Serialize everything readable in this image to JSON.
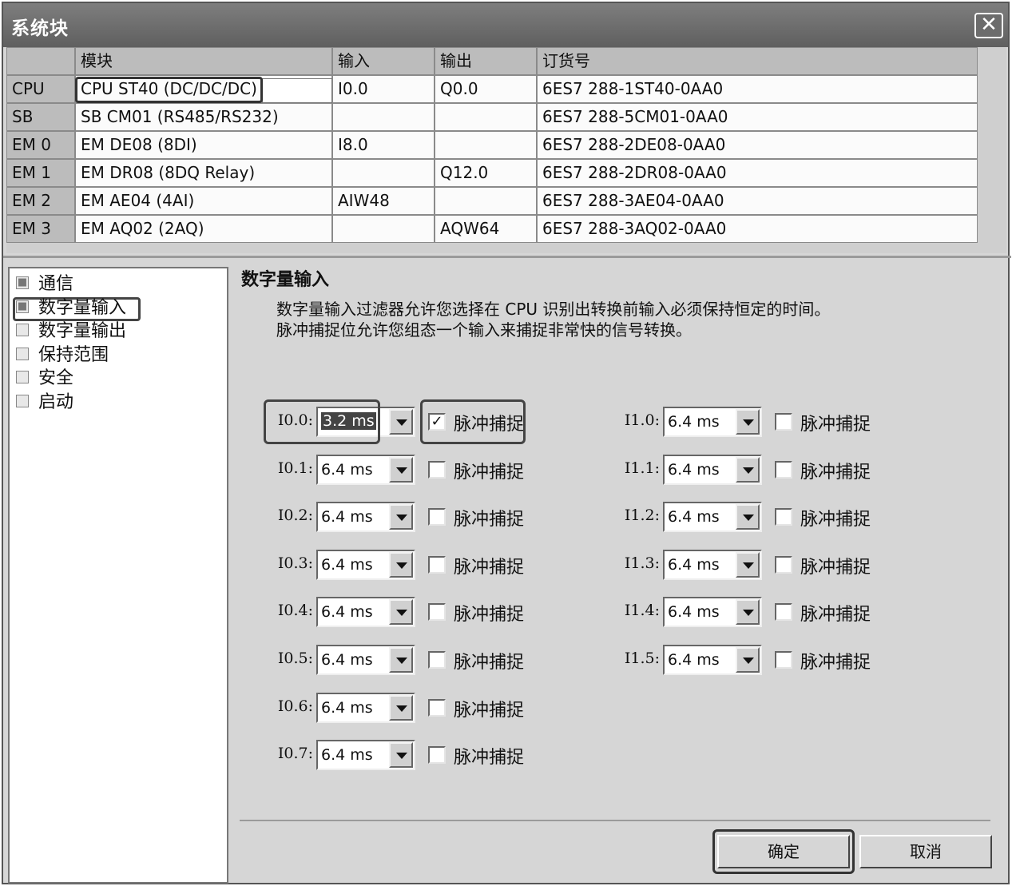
{
  "window": {
    "title": "系统块",
    "close_glyph": "✕"
  },
  "module_table": {
    "headers": [
      "",
      "模块",
      "输入",
      "输出",
      "订货号"
    ],
    "rows": [
      [
        "CPU",
        "CPU ST40 (DC/DC/DC)",
        "I0.0",
        "Q0.0",
        "6ES7 288-1ST40-0AA0"
      ],
      [
        "SB",
        "SB CM01 (RS485/RS232)",
        "",
        "",
        "6ES7 288-5CM01-0AA0"
      ],
      [
        "EM 0",
        "EM DE08 (8DI)",
        "I8.0",
        "",
        "6ES7 288-2DE08-0AA0"
      ],
      [
        "EM 1",
        "EM DR08 (8DQ Relay)",
        "",
        "Q12.0",
        "6ES7 288-2DR08-0AA0"
      ],
      [
        "EM 2",
        "EM AE04 (4AI)",
        "AIW48",
        "",
        "6ES7 288-3AE04-0AA0"
      ],
      [
        "EM 3",
        "EM AQ02 (2AQ)",
        "",
        "AQW64",
        "6ES7 288-3AQ02-0AA0"
      ]
    ]
  },
  "tree": {
    "items": [
      {
        "label": "通信",
        "checked": true
      },
      {
        "label": "数字量输入",
        "checked": true,
        "selected": true
      },
      {
        "label": "数字量输出",
        "checked": false
      },
      {
        "label": "保持范围",
        "checked": false
      },
      {
        "label": "安全",
        "checked": false
      },
      {
        "label": "启动",
        "checked": false
      }
    ]
  },
  "panel": {
    "title": "数字量输入",
    "desc_line1": "数字量输入过滤器允许您选择在 CPU 识别出转换前输入必须保持恒定的时间。",
    "desc_line2": "脉冲捕捉位允许您组态一个输入来捕捉非常快的信号转换。",
    "pulse_label": "脉冲捕捉",
    "check_glyph": "✓",
    "left_channels": [
      {
        "label": "I0.0:",
        "value": "3.2 ms",
        "pulse": true
      },
      {
        "label": "I0.1:",
        "value": "6.4 ms",
        "pulse": false
      },
      {
        "label": "I0.2:",
        "value": "6.4 ms",
        "pulse": false
      },
      {
        "label": "I0.3:",
        "value": "6.4 ms",
        "pulse": false
      },
      {
        "label": "I0.4:",
        "value": "6.4 ms",
        "pulse": false
      },
      {
        "label": "I0.5:",
        "value": "6.4 ms",
        "pulse": false
      },
      {
        "label": "I0.6:",
        "value": "6.4 ms",
        "pulse": false
      },
      {
        "label": "I0.7:",
        "value": "6.4 ms",
        "pulse": false
      }
    ],
    "right_channels": [
      {
        "label": "I1.0:",
        "value": "6.4 ms",
        "pulse": false
      },
      {
        "label": "I1.1:",
        "value": "6.4 ms",
        "pulse": false
      },
      {
        "label": "I1.2:",
        "value": "6.4 ms",
        "pulse": false
      },
      {
        "label": "I1.3:",
        "value": "6.4 ms",
        "pulse": false
      },
      {
        "label": "I1.4:",
        "value": "6.4 ms",
        "pulse": false
      },
      {
        "label": "I1.5:",
        "value": "6.4 ms",
        "pulse": false
      }
    ]
  },
  "buttons": {
    "ok": "确定",
    "cancel": "取消"
  }
}
